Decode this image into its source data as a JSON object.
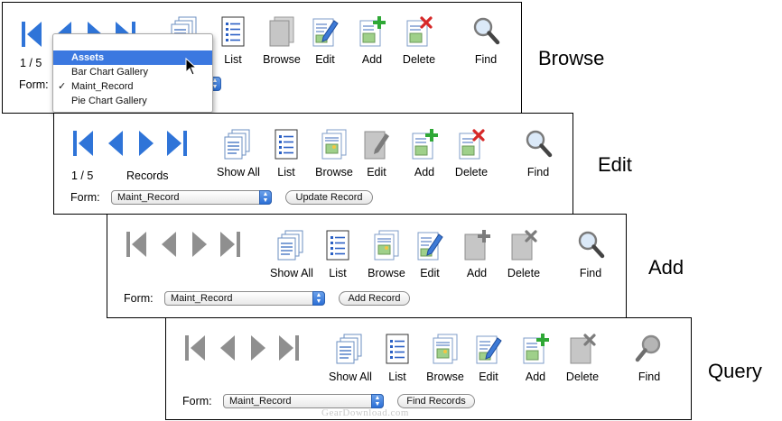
{
  "colors": {
    "nav_active": "#2f74d8",
    "nav_disabled": "#8f8f8f",
    "menu_highlight": "#3b78e0"
  },
  "panels": {
    "browse": {
      "mode": "Browse",
      "record_count": "1 / 5",
      "form_label": "Form:",
      "tools": [
        "List",
        "Browse",
        "Edit",
        "Add",
        "Delete",
        "Find"
      ],
      "menu": {
        "highlighted": "Assets",
        "items": [
          "Bar Chart Gallery",
          "Maint_Record",
          "Pie Chart Gallery"
        ],
        "checked_mark": "✓"
      }
    },
    "edit": {
      "mode": "Edit",
      "record_count": "1 / 5",
      "records_label": "Records",
      "form_label": "Form:",
      "form_value": "Maint_Record",
      "action_button": "Update Record",
      "tools": [
        "Show All",
        "List",
        "Browse",
        "Edit",
        "Add",
        "Delete",
        "Find"
      ]
    },
    "add": {
      "mode": "Add",
      "form_label": "Form:",
      "form_value": "Maint_Record",
      "action_button": "Add Record",
      "tools": [
        "Show All",
        "List",
        "Browse",
        "Edit",
        "Add",
        "Delete",
        "Find"
      ]
    },
    "query": {
      "mode": "Query",
      "form_label": "Form:",
      "form_value": "Maint_Record",
      "action_button": "Find Records",
      "tools": [
        "Show All",
        "List",
        "Browse",
        "Edit",
        "Add",
        "Delete",
        "Find"
      ]
    }
  },
  "watermark": "GearDownload.com"
}
